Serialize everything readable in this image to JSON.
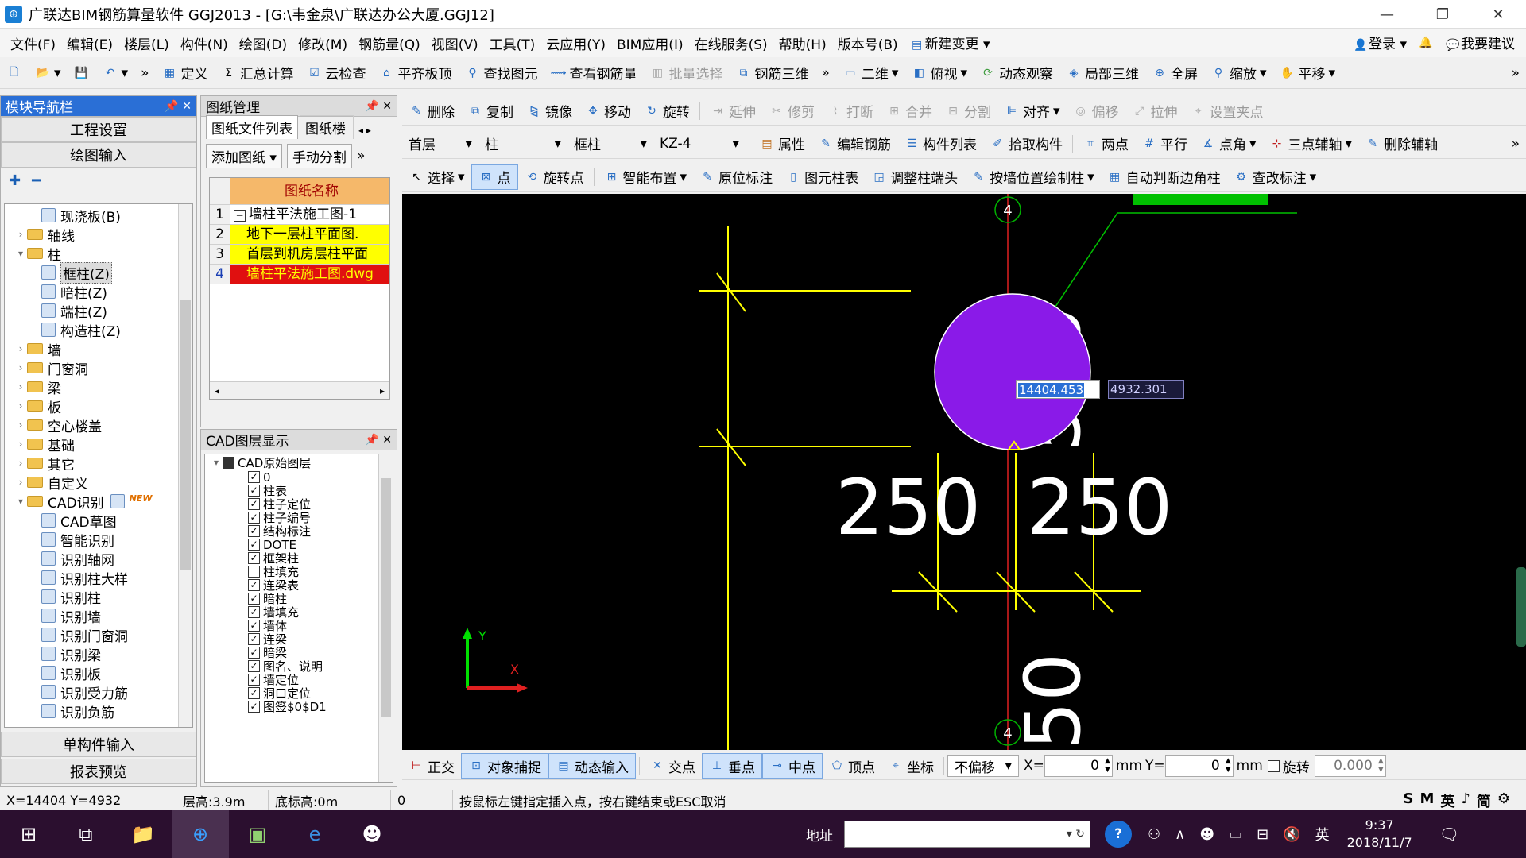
{
  "window": {
    "title": "广联达BIM钢筋算量软件 GGJ2013 - [G:\\韦金泉\\广联达办公大厦.GGJ12]"
  },
  "menu": {
    "items": [
      "文件(F)",
      "编辑(E)",
      "楼层(L)",
      "构件(N)",
      "绘图(D)",
      "修改(M)",
      "钢筋量(Q)",
      "视图(V)",
      "工具(T)",
      "云应用(Y)",
      "BIM应用(I)",
      "在线服务(S)",
      "帮助(H)",
      "版本号(B)",
      "新建变更"
    ],
    "login": "登录",
    "suggest": "我要建议"
  },
  "toolbar1": {
    "items": [
      "定义",
      "汇总计算",
      "云检查",
      "平齐板顶",
      "查找图元",
      "查看钢筋量",
      "批量选择",
      "钢筋三维",
      "二维",
      "俯视",
      "动态观察",
      "局部三维",
      "全屏",
      "缩放",
      "平移"
    ]
  },
  "toolbar2": {
    "items": [
      "删除",
      "复制",
      "镜像",
      "移动",
      "旋转",
      "延伸",
      "修剪",
      "打断",
      "合并",
      "分割",
      "对齐",
      "偏移",
      "拉伸",
      "设置夹点"
    ]
  },
  "toolbar3": {
    "floor": "首层",
    "category": "柱",
    "type": "框柱",
    "component": "KZ-4",
    "items": [
      "属性",
      "编辑钢筋",
      "构件列表",
      "拾取构件",
      "两点",
      "平行",
      "点角",
      "三点辅轴",
      "删除辅轴"
    ]
  },
  "toolbar4": {
    "items": [
      "选择",
      "点",
      "旋转点",
      "智能布置",
      "原位标注",
      "图元柱表",
      "调整柱端头",
      "按墙位置绘制柱",
      "自动判断边角柱",
      "查改标注"
    ]
  },
  "nav": {
    "title": "模块导航栏",
    "project_settings": "工程设置",
    "drawing_input": "绘图输入",
    "single_input": "单构件输入",
    "report_preview": "报表预览",
    "tree": [
      {
        "label": "现浇板(B)",
        "level": 2,
        "kind": "item"
      },
      {
        "label": "轴线",
        "level": 1,
        "kind": "folder"
      },
      {
        "label": "柱",
        "level": 1,
        "kind": "folder",
        "expanded": true
      },
      {
        "label": "框柱(Z)",
        "level": 2,
        "kind": "item",
        "selected": true
      },
      {
        "label": "暗柱(Z)",
        "level": 2,
        "kind": "item"
      },
      {
        "label": "端柱(Z)",
        "level": 2,
        "kind": "item"
      },
      {
        "label": "构造柱(Z)",
        "level": 2,
        "kind": "item"
      },
      {
        "label": "墙",
        "level": 1,
        "kind": "folder"
      },
      {
        "label": "门窗洞",
        "level": 1,
        "kind": "folder"
      },
      {
        "label": "梁",
        "level": 1,
        "kind": "folder"
      },
      {
        "label": "板",
        "level": 1,
        "kind": "folder"
      },
      {
        "label": "空心楼盖",
        "level": 1,
        "kind": "folder"
      },
      {
        "label": "基础",
        "level": 1,
        "kind": "folder"
      },
      {
        "label": "其它",
        "level": 1,
        "kind": "folder"
      },
      {
        "label": "自定义",
        "level": 1,
        "kind": "folder"
      },
      {
        "label": "CAD识别",
        "level": 1,
        "kind": "folder",
        "expanded": true,
        "badge": "NEW"
      },
      {
        "label": "CAD草图",
        "level": 2,
        "kind": "item"
      },
      {
        "label": "智能识别",
        "level": 2,
        "kind": "item"
      },
      {
        "label": "识别轴网",
        "level": 2,
        "kind": "item"
      },
      {
        "label": "识别柱大样",
        "level": 2,
        "kind": "item"
      },
      {
        "label": "识别柱",
        "level": 2,
        "kind": "item"
      },
      {
        "label": "识别墙",
        "level": 2,
        "kind": "item"
      },
      {
        "label": "识别门窗洞",
        "level": 2,
        "kind": "item"
      },
      {
        "label": "识别梁",
        "level": 2,
        "kind": "item"
      },
      {
        "label": "识别板",
        "level": 2,
        "kind": "item"
      },
      {
        "label": "识别受力筋",
        "level": 2,
        "kind": "item"
      },
      {
        "label": "识别负筋",
        "level": 2,
        "kind": "item"
      }
    ]
  },
  "drawings": {
    "title": "图纸管理",
    "tabs": [
      "图纸文件列表",
      "图纸楼"
    ],
    "add_button": "添加图纸",
    "split_button": "手动分割",
    "column_header": "图纸名称",
    "rows": [
      {
        "num": "1",
        "name": "墙柱平法施工图-1",
        "style": "normal"
      },
      {
        "num": "2",
        "name": "地下一层柱平面图.",
        "style": "yellow"
      },
      {
        "num": "3",
        "name": "首层到机房层柱平面",
        "style": "yellow"
      },
      {
        "num": "4",
        "name": "墙柱平法施工图.dwg",
        "style": "red"
      }
    ]
  },
  "layers": {
    "title": "CAD图层显示",
    "root": "CAD原始图层",
    "items": [
      {
        "name": "0",
        "checked": true
      },
      {
        "name": "柱表",
        "checked": true
      },
      {
        "name": "柱子定位",
        "checked": true
      },
      {
        "name": "柱子编号",
        "checked": true
      },
      {
        "name": "结构标注",
        "checked": true
      },
      {
        "name": "DOTE",
        "checked": true
      },
      {
        "name": "框架柱",
        "checked": true
      },
      {
        "name": "柱填充",
        "checked": false
      },
      {
        "name": "连梁表",
        "checked": true
      },
      {
        "name": "暗柱",
        "checked": true
      },
      {
        "name": "墙填充",
        "checked": true
      },
      {
        "name": "墙体",
        "checked": true
      },
      {
        "name": "连梁",
        "checked": true
      },
      {
        "name": "暗梁",
        "checked": true
      },
      {
        "name": "图名、说明",
        "checked": true
      },
      {
        "name": "墙定位",
        "checked": true
      },
      {
        "name": "洞口定位",
        "checked": true
      },
      {
        "name": "图签$0$D1",
        "checked": true
      }
    ]
  },
  "canvas": {
    "dim_vertical": "500",
    "dim_bottom_left": "250",
    "dim_bottom_right": "250",
    "dim_partial": "50",
    "axis_label": "4",
    "axis_label_bottom": "4",
    "coord_x_input": "14404.453",
    "coord_y_input": "4932.301",
    "ucs_y": "Y",
    "ucs_x": "X"
  },
  "snapbar": {
    "items": [
      "正交",
      "对象捕捉",
      "动态输入",
      "交点",
      "垂点",
      "中点",
      "顶点",
      "坐标"
    ],
    "offset_mode": "不偏移",
    "x_label": "X=",
    "x_value": "0",
    "y_label": "Y=",
    "y_value": "0",
    "unit": "mm",
    "rotate_label": "旋转",
    "rotate_value": "0.000"
  },
  "status": {
    "coords": "X=14404 Y=4932",
    "floor_height": "层高:3.9m",
    "base_height": "底标高:0m",
    "zero": "0",
    "hint": "按鼠标左键指定插入点，按右键结束或ESC取消"
  },
  "taskbar": {
    "address_label": "地址",
    "time": "9:37",
    "date": "2018/11/7",
    "lang": "英"
  },
  "colors": {
    "canvas_bg": "#000000",
    "column_fill": "#8a1ae8",
    "dim_yellow": "#ffff00",
    "axis_red": "#e02020",
    "leader_green": "#00c000",
    "selected_red": "#e01010",
    "selected_yellow": "#ffff00",
    "header_orange": "#f5b86a"
  }
}
